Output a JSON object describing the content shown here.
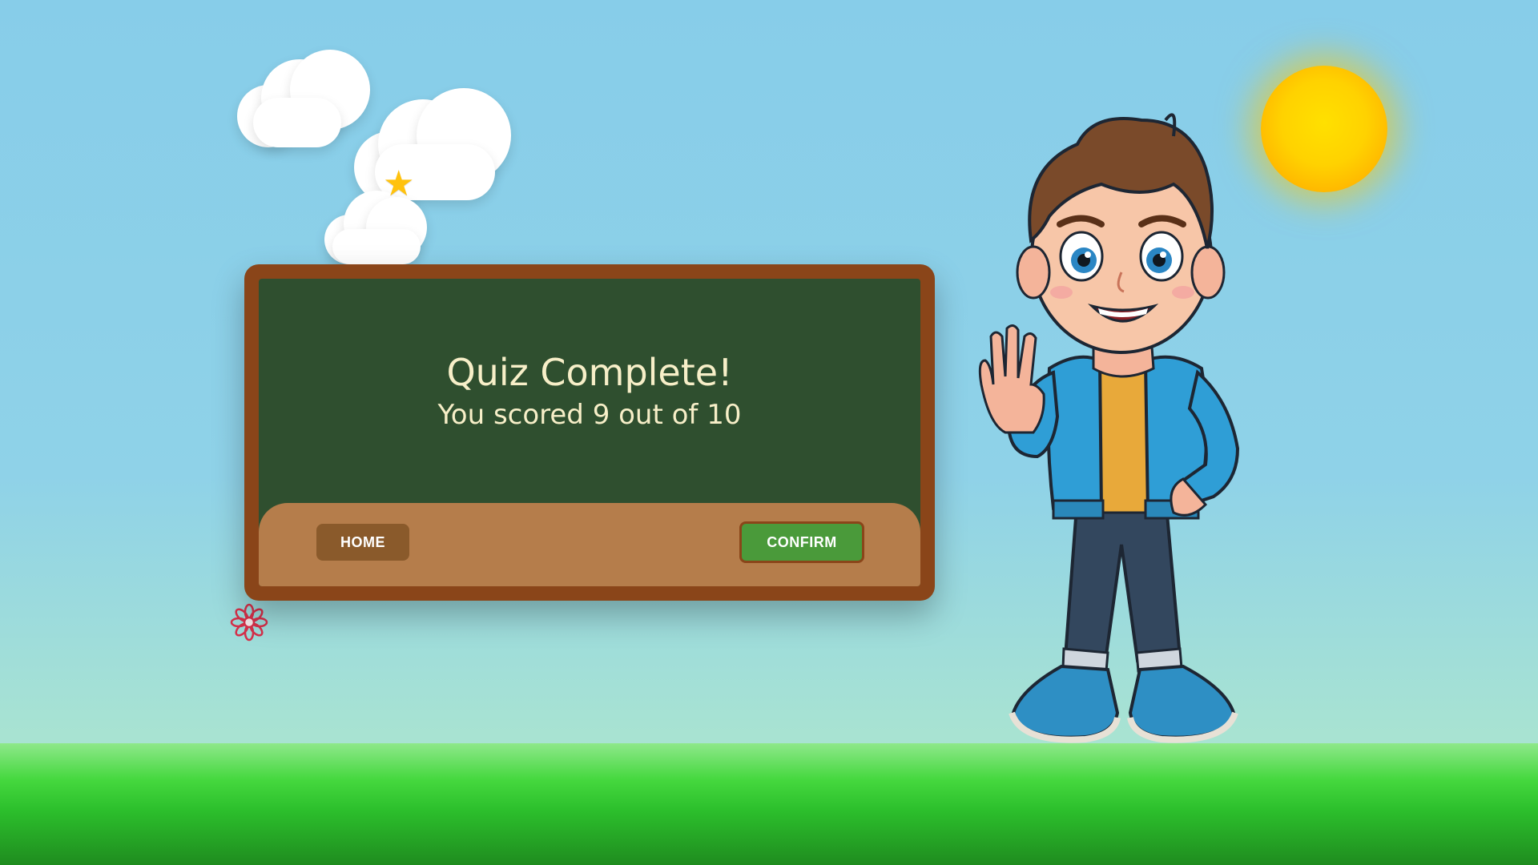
{
  "quiz": {
    "title": "Quiz Complete!",
    "score_text": "You scored 9 out of 10"
  },
  "buttons": {
    "home_label": "HOME",
    "confirm_label": "CONFIRM"
  },
  "decor": {
    "star_glyph": "★",
    "icons": [
      "cloud-icon",
      "star-icon",
      "sun-icon",
      "flower-icon",
      "waving-boy-illustration"
    ]
  },
  "colors": {
    "sky": "#87cde9",
    "ground": "#2cbf2c",
    "board_frame": "#8a4519",
    "chalkboard": "#2f4f2f",
    "chalk_text": "#f7efc8",
    "tray": "#b57d4b",
    "home_button": "#8a5a2b",
    "confirm_button": "#4a9a3a",
    "sun": "#ffd200"
  }
}
